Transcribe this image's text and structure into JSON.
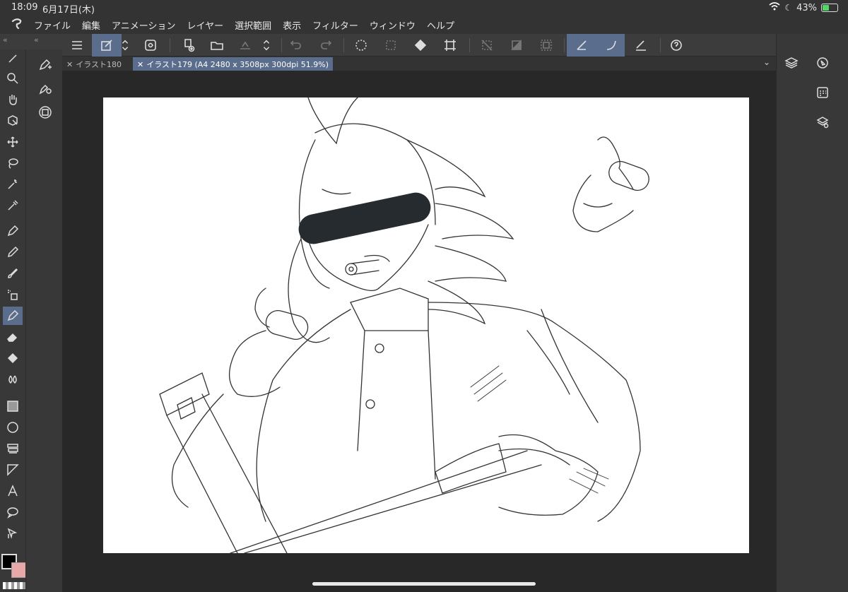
{
  "status": {
    "time": "18:09",
    "date": "6月17日(木)",
    "battery": "43%"
  },
  "menu": [
    "ファイル",
    "編集",
    "アニメーション",
    "レイヤー",
    "選択範囲",
    "表示",
    "フィルター",
    "ウィンドウ",
    "ヘルプ"
  ],
  "tabs": [
    {
      "label": "イラスト180",
      "active": false
    },
    {
      "label": "イラスト179 (A4 2480 x 3508px 300dpi 51.9%)",
      "active": true
    }
  ],
  "colors": {
    "main": "#000000",
    "sub": "#e8a8a8",
    "accent": "#5a6d8c"
  }
}
